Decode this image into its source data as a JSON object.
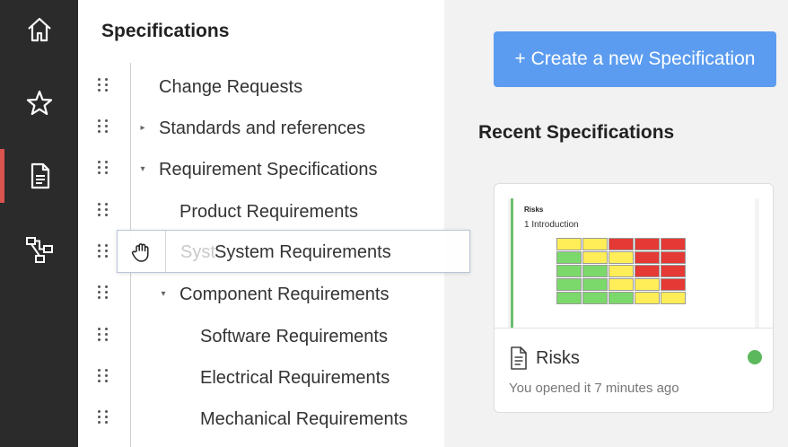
{
  "rail": {
    "items": [
      {
        "name": "home-icon",
        "active": false
      },
      {
        "name": "star-icon",
        "active": false
      },
      {
        "name": "document-icon",
        "active": true
      },
      {
        "name": "hierarchy-icon",
        "active": false
      }
    ]
  },
  "specifications": {
    "title": "Specifications",
    "tree": [
      {
        "label": "Change Requests"
      },
      {
        "label": "Standards and references",
        "caret": "▸"
      },
      {
        "label": "Requirement Specifications",
        "caret": "▾"
      },
      {
        "label": "Product Requirements"
      },
      {
        "label": "Syst"
      },
      {
        "label": "Component Requirements",
        "caret": "▾"
      },
      {
        "label": "Software Requirements"
      },
      {
        "label": "Electrical Requirements"
      },
      {
        "label": "Mechanical Requirements"
      }
    ],
    "drag_ghost": {
      "label": "System Requirements"
    }
  },
  "main": {
    "create_button": "+ Create a new Specification",
    "recent_title": "Recent Specifications",
    "recent": [
      {
        "name": "Risks",
        "meta": "You opened it 7 minutes ago",
        "status_color": "#5cb85c",
        "preview": {
          "title": "Risks",
          "heading": "1 Introduction"
        }
      }
    ]
  },
  "colors": {
    "accent": "#5b9cf0",
    "rail_bg": "#2b2b2b",
    "active_marker": "#d9534f",
    "risk_red": "#e53935",
    "risk_yellow": "#ffee58",
    "risk_green": "#7bd96b"
  }
}
